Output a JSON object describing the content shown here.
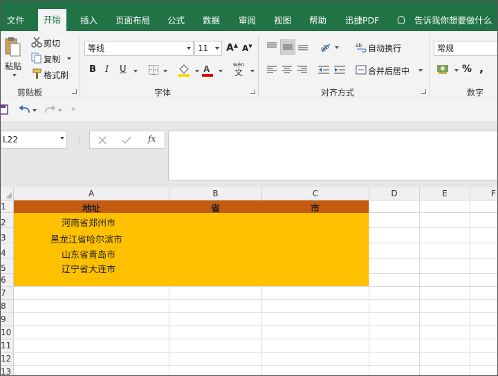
{
  "ribbon_tabs": [
    "文件",
    "开始",
    "插入",
    "页面布局",
    "公式",
    "数据",
    "审阅",
    "视图",
    "帮助",
    "迅捷PDF",
    "告诉我你想要做什么"
  ],
  "active_tab": "开始",
  "clipboard": {
    "paste": "粘贴",
    "cut": "剪切",
    "copy": "复制",
    "format_painter": "格式刷",
    "group_label": "剪贴板"
  },
  "font": {
    "name": "等线",
    "size": "11",
    "bold": "B",
    "italic": "I",
    "underline": "U",
    "wen_top": "wén",
    "wen_bottom": "文",
    "group_label": "字体"
  },
  "alignment": {
    "wrap_text": "自动换行",
    "merge_center": "合并后居中",
    "group_label": "对齐方式"
  },
  "number": {
    "format": "常规",
    "percent": "%",
    "comma": ",",
    "group_label": "数字"
  },
  "formula_bar": {
    "name_box": "L22",
    "fx": "fx",
    "value": ""
  },
  "columns": [
    "A",
    "B",
    "C",
    "D",
    "E",
    "F"
  ],
  "rows": [
    "1",
    "2",
    "3",
    "4",
    "5",
    "6",
    "7",
    "8",
    "9",
    "10",
    "11",
    "12",
    "13"
  ],
  "header_row": {
    "A": "地址",
    "B": "省",
    "C": "市"
  },
  "addresses": [
    "河南省郑州市",
    "黑龙江省哈尔滨市",
    "山东省青岛市",
    "辽宁省大连市"
  ],
  "colors": {
    "ribbon_green": "#217346",
    "header_fill": "#C55A11",
    "data_fill": "#FFC000",
    "font_color_red": "#E00000",
    "highlight_yellow": "#FFD800"
  }
}
